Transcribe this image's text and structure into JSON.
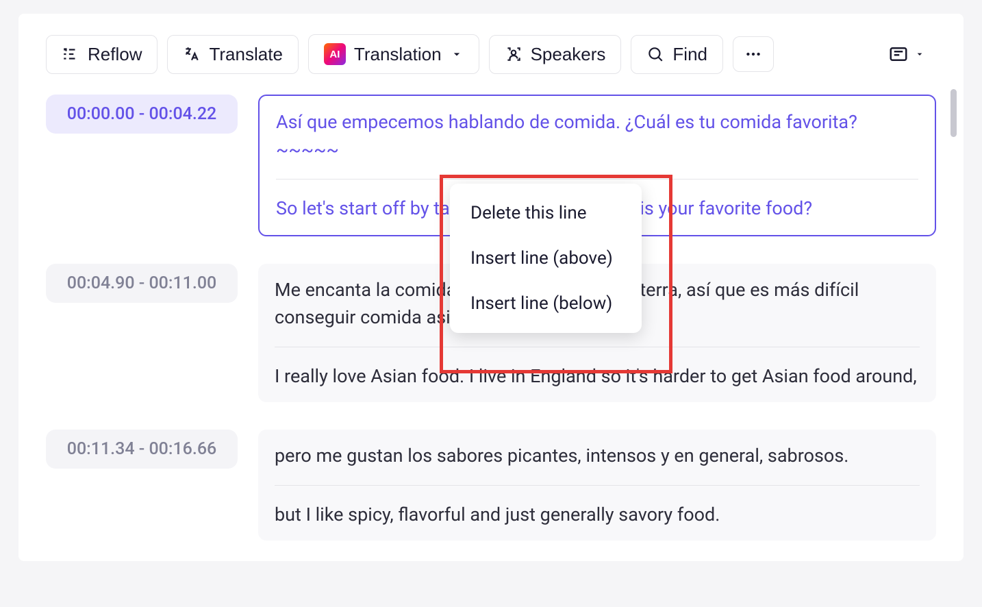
{
  "toolbar": {
    "reflow": "Reflow",
    "translate": "Translate",
    "translation": "Translation",
    "speakers": "Speakers",
    "find": "Find",
    "ai_badge": "AI"
  },
  "context_menu": {
    "delete": "Delete this line",
    "insert_above": "Insert line (above)",
    "insert_below": "Insert line (below)"
  },
  "rows": [
    {
      "time": "00:00.00 - 00:04.22",
      "active": true,
      "source": "Así que empecemos hablando de comida. ¿Cuál es tu comida favorita?~~~~~",
      "translation": "So let's start off by talking about food. What is your favorite food?"
    },
    {
      "time": "00:04.90  -  00:11.00",
      "active": false,
      "source": "Me encanta la comida asiática. Vivo en Inglaterra, así que es más difícil conseguir comida asiática por aquí,",
      "translation": "I really love Asian food. I live in England so it's harder to get Asian food around,"
    },
    {
      "time": "00:11.34  -  00:16.66",
      "active": false,
      "source": "pero me gustan los sabores picantes, intensos y en general, sabrosos.",
      "translation": "but I like spicy, flavorful and just generally savory food."
    }
  ]
}
